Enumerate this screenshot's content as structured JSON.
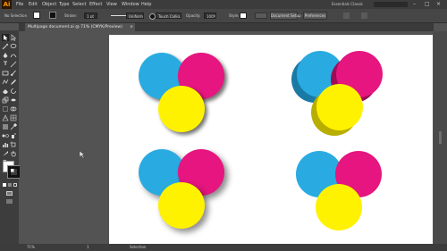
{
  "app": {
    "logo": "Ai"
  },
  "menu": [
    "File",
    "Edit",
    "Object",
    "Type",
    "Select",
    "Effect",
    "View",
    "Window",
    "Help"
  ],
  "workspace": "Essentials Classic",
  "window_controls": [
    "–",
    "□",
    "×"
  ],
  "control_bar": {
    "selection": "No Selection",
    "stroke_label": "Stroke:",
    "stroke_value": "1 pt",
    "uniform": "Uniform",
    "brush": "Touch Callig...",
    "opacity_label": "Opacity:",
    "opacity_value": "100%",
    "style_label": "Style:",
    "document_setup": "Document Setup",
    "preferences": "Preferences"
  },
  "document_tab": {
    "title": "Multipage document.ai @ 71% (CMYK/Preview)",
    "close": "×"
  },
  "status_bar": {
    "zoom": "71%",
    "page": "1",
    "tool": "Selection"
  },
  "colors": {
    "cyan": "#29abe2",
    "magenta": "#e6157f",
    "yellow": "#fff200",
    "cyan_side": "#1a7aa6",
    "magenta_side": "#9c0d56",
    "yellow_side": "#b8ae00"
  }
}
